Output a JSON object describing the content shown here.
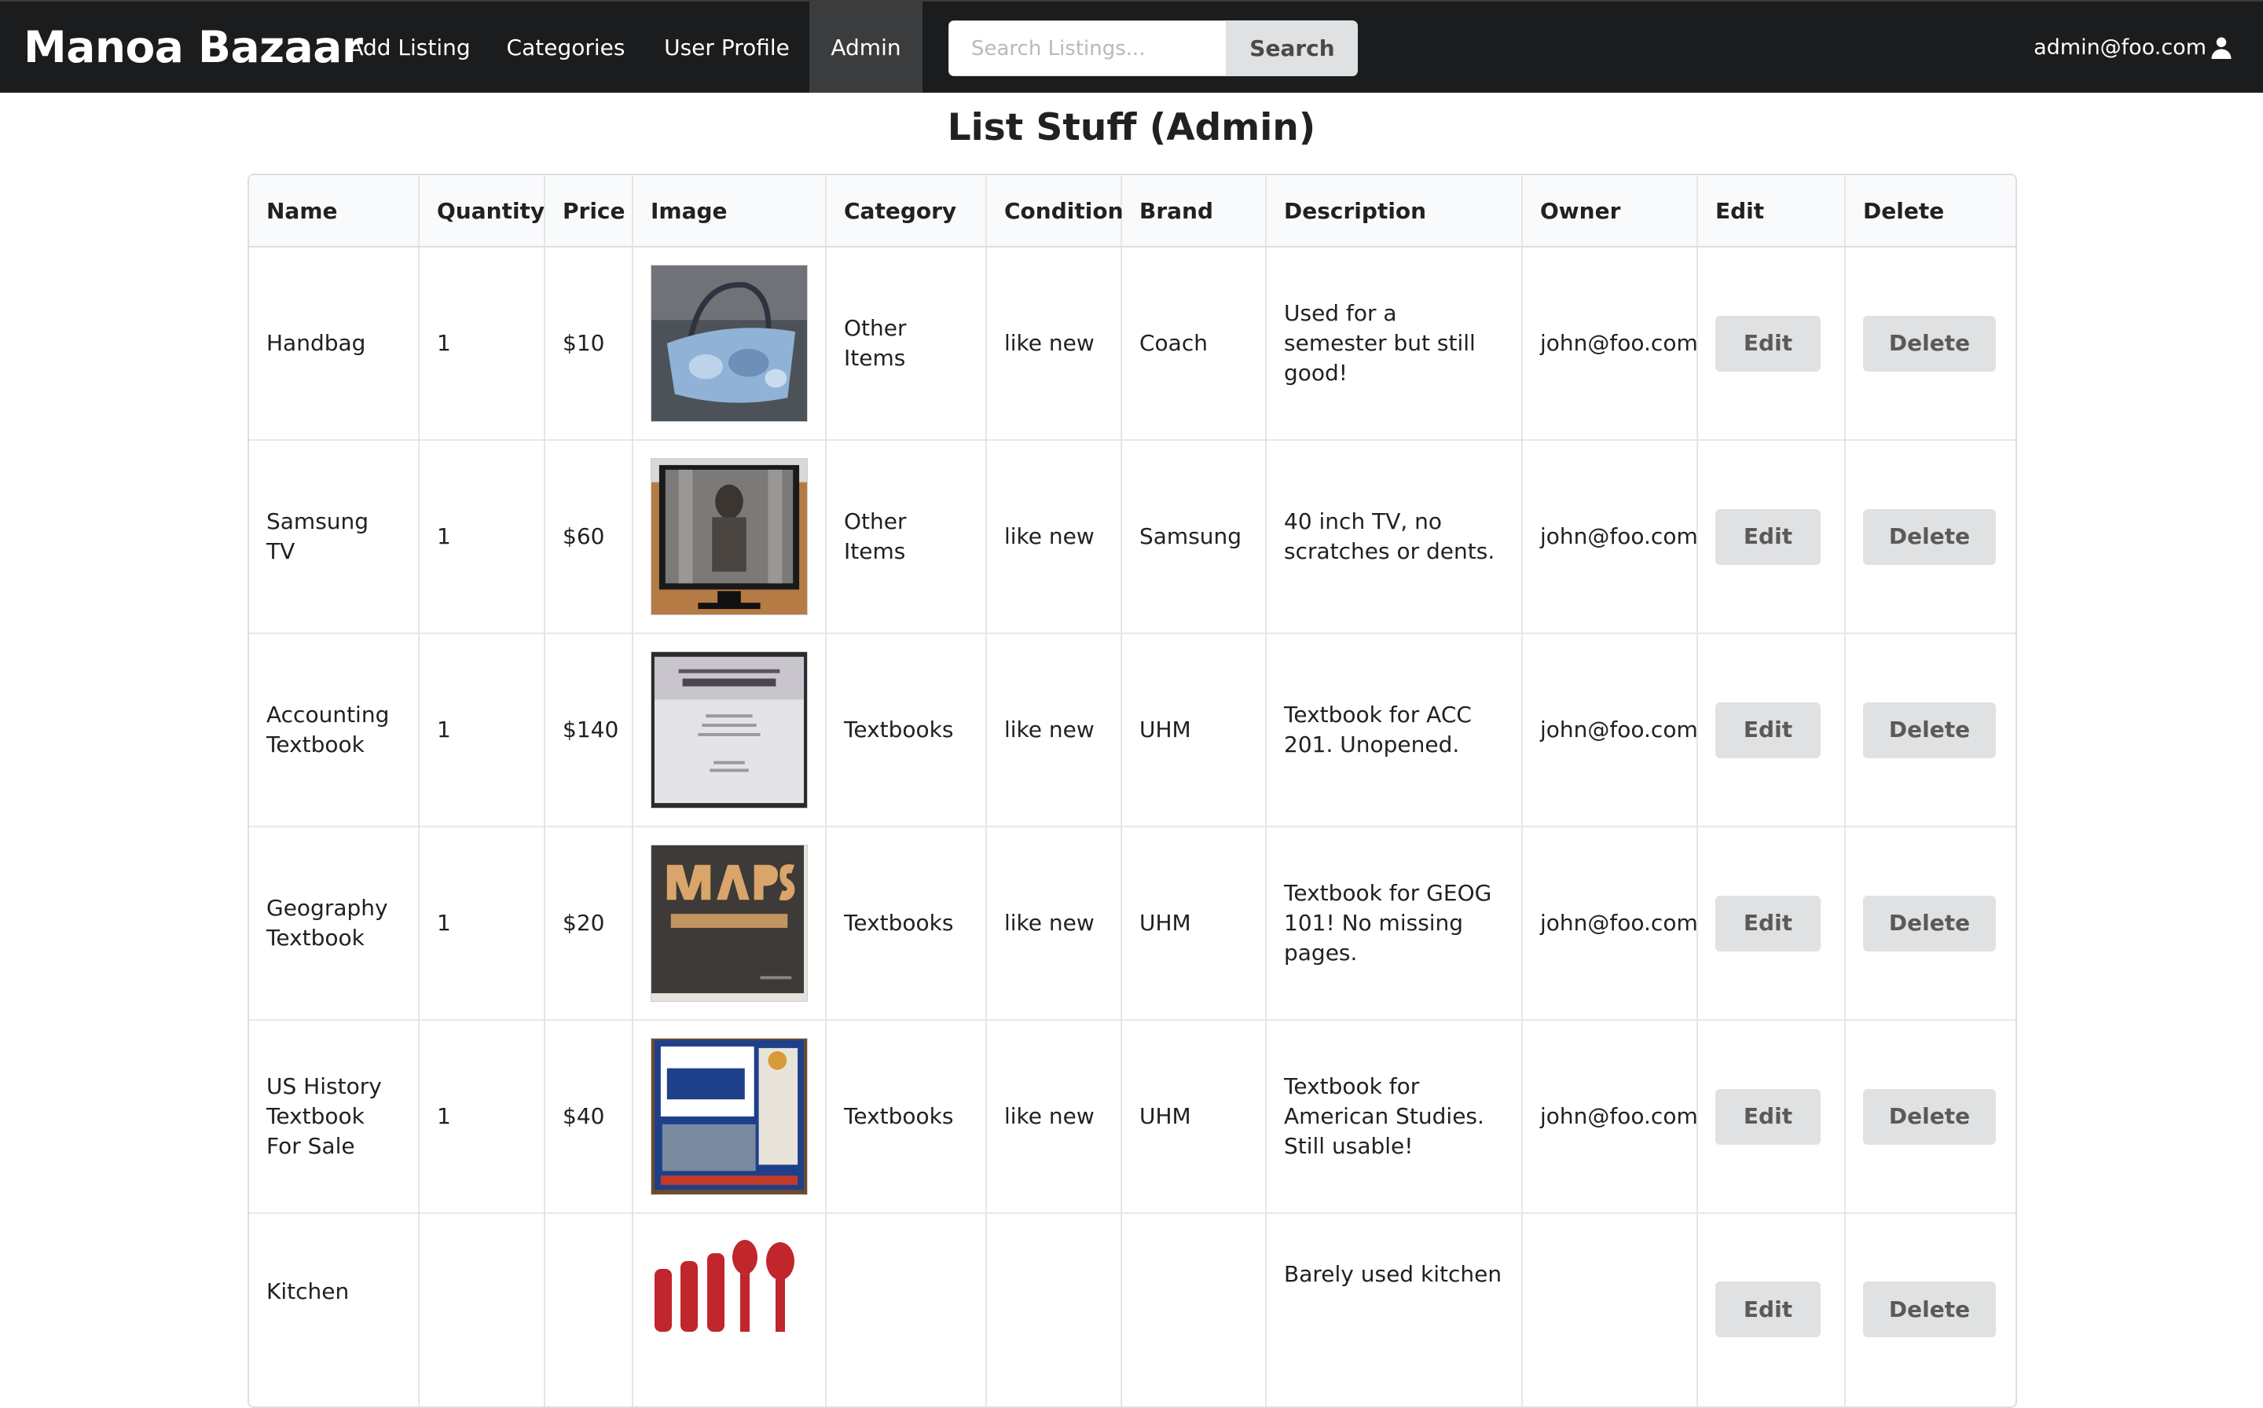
{
  "navbar": {
    "brand": "Manoa Bazaar",
    "items": [
      {
        "label": "Add Listing",
        "active": false
      },
      {
        "label": "Categories",
        "active": false
      },
      {
        "label": "User Profile",
        "active": false
      },
      {
        "label": "Admin",
        "active": true
      }
    ],
    "search": {
      "placeholder": "Search Listings...",
      "value": "",
      "button_label": "Search"
    },
    "user": {
      "email": "admin@foo.com",
      "icon": "user-icon"
    }
  },
  "page": {
    "title": "List Stuff (Admin)"
  },
  "table": {
    "columns": [
      "Name",
      "Quantity",
      "Price",
      "Image",
      "Category",
      "Condition",
      "Brand",
      "Description",
      "Owner",
      "Edit",
      "Delete"
    ],
    "rows": [
      {
        "name": "Handbag",
        "quantity": "1",
        "price": "$10",
        "image": "handbag-photo",
        "category": "Other Items",
        "condition": "like new",
        "brand": "Coach",
        "description": "Used for a semester but still good!",
        "owner": "john@foo.com",
        "edit_label": "Edit",
        "delete_label": "Delete"
      },
      {
        "name": "Samsung TV",
        "quantity": "1",
        "price": "$60",
        "image": "tv-photo",
        "category": "Other Items",
        "condition": "like new",
        "brand": "Samsung",
        "description": "40 inch TV, no scratches or dents.",
        "owner": "john@foo.com",
        "edit_label": "Edit",
        "delete_label": "Delete"
      },
      {
        "name": "Accounting Textbook",
        "quantity": "1",
        "price": "$140",
        "image": "accounting-book-photo",
        "category": "Textbooks",
        "condition": "like new",
        "brand": "UHM",
        "description": "Textbook for ACC 201. Unopened.",
        "owner": "john@foo.com",
        "edit_label": "Edit",
        "delete_label": "Delete"
      },
      {
        "name": "Geography Textbook",
        "quantity": "1",
        "price": "$20",
        "image": "maps-book-photo",
        "category": "Textbooks",
        "condition": "like new",
        "brand": "UHM",
        "description": "Textbook for GEOG 101! No missing pages.",
        "owner": "john@foo.com",
        "edit_label": "Edit",
        "delete_label": "Delete"
      },
      {
        "name": "US History Textbook For Sale",
        "quantity": "1",
        "price": "$40",
        "image": "us-history-book-photo",
        "category": "Textbooks",
        "condition": "like new",
        "brand": "UHM",
        "description": "Textbook for American Studies. Still usable!",
        "owner": "john@foo.com",
        "edit_label": "Edit",
        "delete_label": "Delete"
      },
      {
        "name": "Kitchen",
        "quantity": "",
        "price": "",
        "image": "kitchen-utensils-photo",
        "category": "",
        "condition": "",
        "brand": "",
        "description": "Barely used kitchen",
        "owner": "",
        "edit_label": "Edit",
        "delete_label": "Delete"
      }
    ]
  },
  "colors": {
    "navbar_bg": "#1b1c1d",
    "navbar_active": "#3b3c3d",
    "button_bg": "#e0e1e2",
    "table_header_bg": "#f9fafb"
  }
}
